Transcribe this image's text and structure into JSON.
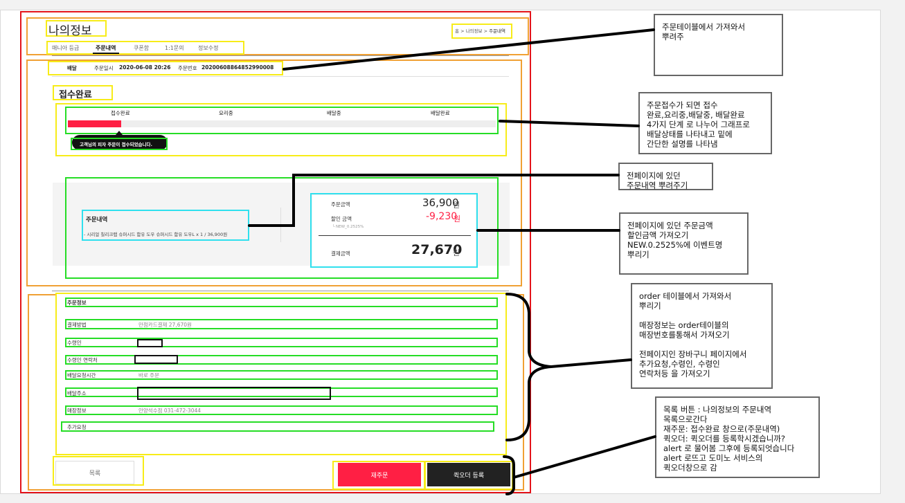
{
  "page": {
    "title": "나의정보",
    "breadcrumb": [
      "홈",
      "나의정보",
      "주문내역"
    ],
    "tabs": [
      "매니아 등급",
      "주문내역",
      "쿠폰함",
      "1:1문의",
      "정보수정"
    ]
  },
  "order": {
    "type": "배달",
    "date_label": "주문일시",
    "date": "2020-06-08 20:26",
    "no_label": "주문번호",
    "no": "20200608864852990008",
    "status_title": "접수완료",
    "steps": [
      "접수완료",
      "요리중",
      "배달중",
      "배달완료"
    ],
    "progress": 0.125,
    "tooltip": "고객님의 피자 주문이 접수되었습니다."
  },
  "summary": {
    "history_title": "주문내역",
    "history_item": "- 시리얼 칠리크랩 슈퍼시드 함유 도우 슈퍼시드 함유 도우L x 1 / 36,900원",
    "order_amount_label": "주문금액",
    "order_amount": "36,900",
    "discount_label": "할인 금액",
    "discount": "-9,230",
    "discount_note": "└ NEW_0.2525%",
    "pay_label": "결제금액",
    "pay_amount": "27,670",
    "won": "원"
  },
  "info": {
    "section_title": "주문정보",
    "payment_label": "결제방법",
    "payment_value": "만점카드결제 27,670원",
    "receiver_label": "수령인",
    "phone_label": "수령인 연락처",
    "time_label": "배달요청시간",
    "time_value": "바로 주문",
    "address_label": "배달주소",
    "store_label": "매장정보",
    "store_value": "안양석수점 031-472-3044",
    "extra_label": "추가요청"
  },
  "buttons": {
    "list": "목록",
    "reorder": "재주문",
    "quick": "퀵오더 등록"
  },
  "colors": {
    "accent": "#ff1f44",
    "dark_button": "#222222"
  },
  "notes": {
    "n1": "주문테이블에서 가져와서\n뿌려주",
    "n2": "주문접수가 되면 접수\n완료,요리중,배달중, 배달완료\n4가지 단계 로 나누어 그래프로\n배달상태를 나타내고 밑에\n간단한 설명를 나타냄",
    "n3": "전페이지에 있던\n주문내역 뿌려주기",
    "n4": "전페이지에 있던 주문금액\n할인금액 가져오기\nNEW.0.2525%에 이벤트명\n뿌리기",
    "n5": "order 테이블에서 가져와서\n뿌리기\n\n매장정보는 order테이블의\n매장번호를통해서 가져오기\n\n전페이지인 장바구니 페이지에서\n추가요청,수령인, 수령인\n연락처등 을 가져오기",
    "n6": "목록 버튼 : 나의정보의 주문내역\n목록으로간다\n재주문: 접수완료 창으로(주문내역)\n퀵오더: 퀵오더를 등록학시겠습니까?\nalert 로 물어봄 그후에 등록되엇습니다\nalert 로뜨고 도미노 서비스의\n퀵오더창으로 감"
  }
}
